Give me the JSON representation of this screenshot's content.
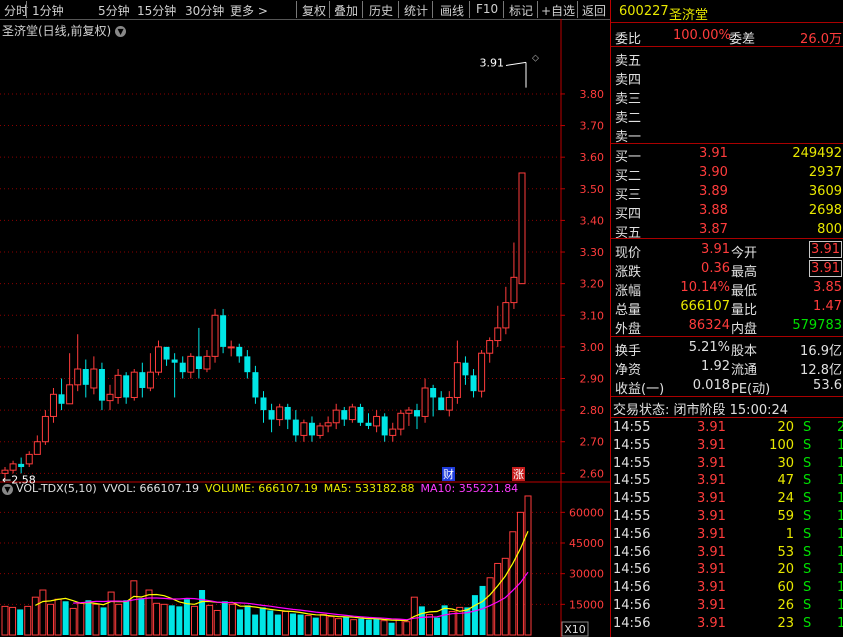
{
  "toolbar": {
    "left": [
      "分时",
      "1分钟",
      "5分钟",
      "15分钟",
      "30分钟",
      "更多 >"
    ],
    "right": [
      "复权",
      "叠加",
      "历史",
      "统计",
      "画线",
      "F10",
      "标记",
      "+自选",
      "返回"
    ]
  },
  "chart": {
    "title": "圣济堂(日线,前复权)",
    "high_marker": "3.91",
    "low_marker": "2.58",
    "badge_cai": "财",
    "badge_zhang": "涨",
    "x10": "X10"
  },
  "volume_legend": {
    "name": "VOL-TDX(5,10)",
    "vvol": "VVOL: 666107.19",
    "volume": "VOLUME: 666107.19",
    "ma5": "MA5: 533182.88",
    "ma10": "MA10: 355221.84"
  },
  "colors": {
    "up": "#ff3c3c",
    "down": "#00e6e6",
    "ma5": "#ffff00",
    "ma10": "#ff00ff",
    "grid": "#8b0000"
  },
  "chart_data": [
    {
      "type": "candlestick",
      "title": "圣济堂(日线,前复权)",
      "y_ticks": [
        "3.80",
        "3.70",
        "3.60",
        "3.50",
        "3.40",
        "3.30",
        "3.20",
        "3.10",
        "3.00",
        "2.90",
        "2.80",
        "2.70",
        "2.60"
      ],
      "ylim": [
        2.56,
        3.92
      ],
      "candles": [
        [
          2.6,
          2.61,
          2.58,
          2.62
        ],
        [
          2.61,
          2.63,
          2.6,
          2.64
        ],
        [
          2.63,
          2.62,
          2.6,
          2.65
        ],
        [
          2.63,
          2.66,
          2.62,
          2.67
        ],
        [
          2.66,
          2.7,
          2.66,
          2.72
        ],
        [
          2.7,
          2.78,
          2.69,
          2.8
        ],
        [
          2.78,
          2.85,
          2.76,
          2.87
        ],
        [
          2.85,
          2.82,
          2.8,
          2.9
        ],
        [
          2.82,
          2.88,
          2.82,
          2.98
        ],
        [
          2.88,
          2.93,
          2.86,
          3.04
        ],
        [
          2.93,
          2.88,
          2.84,
          2.96
        ],
        [
          2.87,
          2.93,
          2.85,
          2.97
        ],
        [
          2.93,
          2.83,
          2.8,
          2.95
        ],
        [
          2.83,
          2.85,
          2.8,
          2.88
        ],
        [
          2.84,
          2.91,
          2.82,
          2.93
        ],
        [
          2.91,
          2.84,
          2.82,
          2.92
        ],
        [
          2.84,
          2.92,
          2.83,
          2.93
        ],
        [
          2.92,
          2.87,
          2.84,
          2.95
        ],
        [
          2.87,
          2.92,
          2.86,
          2.98
        ],
        [
          2.92,
          3.0,
          2.91,
          3.02
        ],
        [
          3.0,
          2.96,
          2.94,
          3.0
        ],
        [
          2.96,
          2.95,
          2.84,
          2.98
        ],
        [
          2.95,
          2.92,
          2.9,
          2.97
        ],
        [
          2.92,
          2.97,
          2.9,
          2.98
        ],
        [
          2.97,
          2.93,
          2.9,
          3.06
        ],
        [
          2.93,
          2.97,
          2.92,
          2.99
        ],
        [
          2.97,
          3.1,
          2.95,
          3.12
        ],
        [
          3.1,
          3.0,
          2.98,
          3.12
        ],
        [
          3.0,
          3.0,
          2.97,
          3.02
        ],
        [
          3.0,
          2.97,
          2.95,
          3.01
        ],
        [
          2.97,
          2.92,
          2.9,
          2.99
        ],
        [
          2.92,
          2.84,
          2.82,
          2.94
        ],
        [
          2.84,
          2.8,
          2.76,
          2.86
        ],
        [
          2.8,
          2.77,
          2.73,
          2.82
        ],
        [
          2.77,
          2.81,
          2.75,
          2.82
        ],
        [
          2.81,
          2.77,
          2.74,
          2.82
        ],
        [
          2.77,
          2.72,
          2.7,
          2.8
        ],
        [
          2.72,
          2.76,
          2.7,
          2.77
        ],
        [
          2.76,
          2.72,
          2.7,
          2.78
        ],
        [
          2.72,
          2.75,
          2.71,
          2.76
        ],
        [
          2.75,
          2.76,
          2.73,
          2.78
        ],
        [
          2.76,
          2.8,
          2.74,
          2.82
        ],
        [
          2.8,
          2.77,
          2.75,
          2.81
        ],
        [
          2.77,
          2.81,
          2.76,
          2.82
        ],
        [
          2.81,
          2.76,
          2.75,
          2.82
        ],
        [
          2.76,
          2.75,
          2.74,
          2.79
        ],
        [
          2.75,
          2.78,
          2.73,
          2.8
        ],
        [
          2.78,
          2.72,
          2.7,
          2.79
        ],
        [
          2.72,
          2.74,
          2.7,
          2.76
        ],
        [
          2.74,
          2.79,
          2.72,
          2.8
        ],
        [
          2.79,
          2.8,
          2.75,
          2.81
        ],
        [
          2.8,
          2.78,
          2.74,
          2.82
        ],
        [
          2.78,
          2.87,
          2.76,
          2.9
        ],
        [
          2.87,
          2.84,
          2.78,
          2.88
        ],
        [
          2.84,
          2.8,
          2.8,
          2.86
        ],
        [
          2.8,
          2.84,
          2.78,
          2.86
        ],
        [
          2.84,
          2.95,
          2.82,
          3.02
        ],
        [
          2.95,
          2.91,
          2.88,
          2.97
        ],
        [
          2.91,
          2.86,
          2.84,
          2.93
        ],
        [
          2.86,
          2.98,
          2.84,
          2.99
        ],
        [
          2.98,
          3.02,
          2.95,
          3.03
        ],
        [
          3.02,
          3.06,
          3.0,
          3.13
        ],
        [
          3.06,
          3.14,
          3.04,
          3.19
        ],
        [
          3.14,
          3.22,
          3.12,
          3.33
        ],
        [
          3.2,
          3.55,
          3.2,
          3.55
        ]
      ]
    },
    {
      "type": "bar",
      "title": "VOL-TDX(5,10)",
      "y_ticks": [
        "60000",
        "45000",
        "30000",
        "15000"
      ],
      "ylim": [
        0,
        67500
      ],
      "values": [
        14000,
        13500,
        12500,
        14000,
        18500,
        22000,
        15000,
        17500,
        16500,
        13000,
        15500,
        17000,
        15000,
        13500,
        21000,
        15000,
        17000,
        26500,
        18000,
        22000,
        15500,
        15000,
        14500,
        14000,
        17500,
        14000,
        22000,
        14500,
        12000,
        16500,
        15000,
        12500,
        14500,
        10000,
        13500,
        12000,
        10000,
        11500,
        10500,
        10000,
        9500,
        8500,
        10000,
        9000,
        8000,
        9000,
        7500,
        8000,
        7500,
        8000,
        7000,
        6000,
        7500,
        6500,
        18500,
        14000,
        10000,
        8500,
        14500,
        11500,
        13500,
        13500,
        19500,
        24000,
        28000,
        35000,
        37500,
        50500,
        60000,
        68000
      ],
      "ma5": [
        null,
        null,
        null,
        null,
        14500,
        16400,
        16700,
        17400,
        17900,
        16800,
        15500,
        15900,
        15400,
        14800,
        16400,
        16300,
        16300,
        18900,
        18600,
        19700,
        19800,
        19200,
        17800,
        16200,
        15300,
        15000,
        16400,
        16400,
        16000,
        15800,
        16000,
        14100,
        14100,
        13700,
        13100,
        12500,
        12100,
        11700,
        11500,
        11000,
        10300,
        9900,
        9800,
        9400,
        9000,
        8900,
        8700,
        8300,
        8000,
        8000,
        7600,
        7300,
        7200,
        7000,
        9100,
        10500,
        11300,
        11500,
        13100,
        12700,
        11600,
        12300,
        14500,
        16400,
        19700,
        24000,
        28800,
        35000,
        42200,
        50700
      ],
      "ma10": [
        null,
        null,
        null,
        null,
        null,
        null,
        null,
        null,
        null,
        15600,
        15800,
        16100,
        16500,
        16400,
        16600,
        16600,
        16500,
        17200,
        17700,
        18100,
        18100,
        17900,
        17600,
        17600,
        17900,
        17800,
        17300,
        16800,
        16100,
        15900,
        15800,
        15700,
        15500,
        15000,
        14500,
        14100,
        13500,
        13000,
        12500,
        12200,
        11700,
        11200,
        10800,
        10400,
        10000,
        9600,
        9200,
        8900,
        8600,
        8400,
        8200,
        7900,
        7800,
        7500,
        8200,
        8600,
        8800,
        8900,
        9800,
        10400,
        10600,
        10900,
        11800,
        12800,
        14400,
        16200,
        18300,
        21800,
        25600,
        30700
      ]
    }
  ],
  "quote": {
    "code": "600227",
    "name": "圣济堂",
    "weibi_label": "委比",
    "weibi_value": "100.00%",
    "weicha_label": "委差",
    "weicha_value": "26.0万",
    "asks": [
      {
        "label": "卖五",
        "price": "",
        "vol": ""
      },
      {
        "label": "卖四",
        "price": "",
        "vol": ""
      },
      {
        "label": "卖三",
        "price": "",
        "vol": ""
      },
      {
        "label": "卖二",
        "price": "",
        "vol": ""
      },
      {
        "label": "卖一",
        "price": "",
        "vol": ""
      }
    ],
    "bids": [
      {
        "label": "买一",
        "price": "3.91",
        "vol": "249492"
      },
      {
        "label": "买二",
        "price": "3.90",
        "vol": "2937"
      },
      {
        "label": "买三",
        "price": "3.89",
        "vol": "3609"
      },
      {
        "label": "买四",
        "price": "3.88",
        "vol": "2698"
      },
      {
        "label": "买五",
        "price": "3.87",
        "vol": "800"
      }
    ],
    "stats": [
      {
        "l1": "现价",
        "v1": "3.91",
        "l2": "今开",
        "v2": "3.91"
      },
      {
        "l1": "涨跌",
        "v1": "0.36",
        "l2": "最高",
        "v2": "3.91"
      },
      {
        "l1": "涨幅",
        "v1": "10.14%",
        "l2": "最低",
        "v2": "3.85"
      },
      {
        "l1": "总量",
        "v1": "666107",
        "l2": "量比",
        "v2": "1.47"
      },
      {
        "l1": "外盘",
        "v1": "86324",
        "l2": "内盘",
        "v2": "579783"
      }
    ],
    "stats2": [
      {
        "l1": "换手",
        "v1": "5.21%",
        "l2": "股本",
        "v2": "16.9亿"
      },
      {
        "l1": "净资",
        "v1": "1.92",
        "l2": "流通",
        "v2": "12.8亿"
      },
      {
        "l1": "收益(一)",
        "v1": "0.018",
        "l2": "PE(动)",
        "v2": "53.6"
      }
    ],
    "trade_status": "交易状态: 闭市阶段  15:00:24",
    "ticks": [
      {
        "time": "14:55",
        "price": "3.91",
        "vol": "20",
        "side": "S",
        "n": "2"
      },
      {
        "time": "14:55",
        "price": "3.91",
        "vol": "100",
        "side": "S",
        "n": "1"
      },
      {
        "time": "14:55",
        "price": "3.91",
        "vol": "30",
        "side": "S",
        "n": "1"
      },
      {
        "time": "14:55",
        "price": "3.91",
        "vol": "47",
        "side": "S",
        "n": "1"
      },
      {
        "time": "14:55",
        "price": "3.91",
        "vol": "24",
        "side": "S",
        "n": "1"
      },
      {
        "time": "14:55",
        "price": "3.91",
        "vol": "59",
        "side": "S",
        "n": "1"
      },
      {
        "time": "14:56",
        "price": "3.91",
        "vol": "1",
        "side": "S",
        "n": "1"
      },
      {
        "time": "14:56",
        "price": "3.91",
        "vol": "53",
        "side": "S",
        "n": "1"
      },
      {
        "time": "14:56",
        "price": "3.91",
        "vol": "20",
        "side": "S",
        "n": "1"
      },
      {
        "time": "14:56",
        "price": "3.91",
        "vol": "60",
        "side": "S",
        "n": "1"
      },
      {
        "time": "14:56",
        "price": "3.91",
        "vol": "26",
        "side": "S",
        "n": "1"
      },
      {
        "time": "14:56",
        "price": "3.91",
        "vol": "23",
        "side": "S",
        "n": "1"
      }
    ]
  }
}
